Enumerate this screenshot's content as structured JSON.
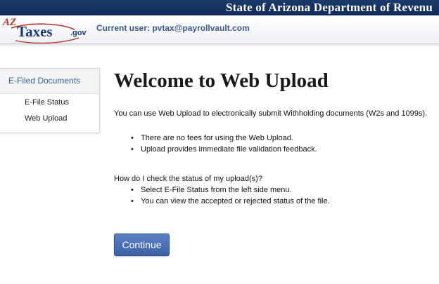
{
  "topbar": {
    "title": "State of Arizona Department of Revenu"
  },
  "header": {
    "logo": {
      "az": "AZ",
      "taxes": "Taxes",
      "gov": ".gov",
      "icon": "aztaxes-logo"
    },
    "current_user": "Current user: pvtax@payrollvault.com"
  },
  "sidebar": {
    "heading": "E-Filed Documents",
    "items": [
      {
        "label": "E-File Status"
      },
      {
        "label": "Web Upload"
      }
    ]
  },
  "main": {
    "title": "Welcome to Web Upload",
    "intro": "You can use Web Upload to electronically submit Withholding documents (W2s and 1099s).",
    "bullets": [
      "There are no fees for using the Web Upload.",
      "Upload provides immediate file validation feedback."
    ],
    "question": "How do I check the status of my upload(s)?",
    "status_bullets": [
      "Select E-File Status from the left side menu.",
      "You can view the accepted or rejected status of the file."
    ],
    "continue_label": "Continue"
  },
  "colors": {
    "topbar": "#1c3a6b",
    "accent": "#3d5f8f",
    "button": "#4a70b6",
    "logo_red": "#b5332a",
    "logo_blue": "#1a3a78"
  }
}
